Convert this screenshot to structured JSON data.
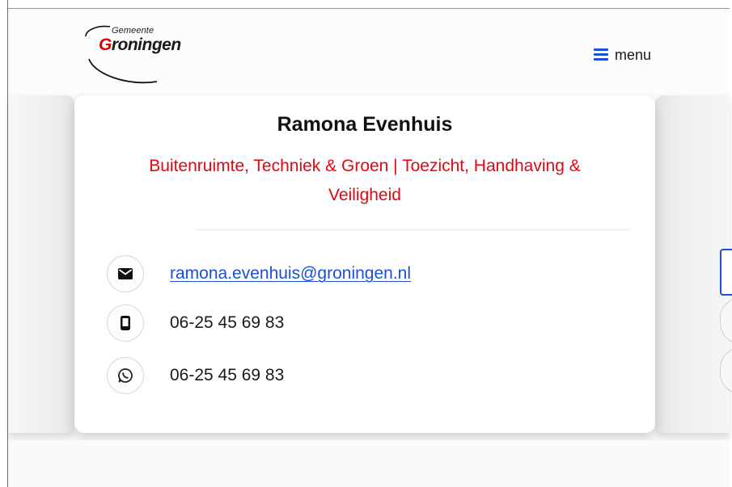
{
  "header": {
    "logo": {
      "subtitle": "Gemeente",
      "name_first_letter": "G",
      "name_rest": "roningen"
    },
    "menu_label": "menu"
  },
  "profile": {
    "name": "Ramona Evenhuis",
    "department": "Buitenruimte, Techniek & Groen | Toezicht, Handhaving & Veiligheid",
    "contacts": {
      "email": "ramona.evenhuis@groningen.nl",
      "phone": "06-25 45 69 83",
      "whatsapp": "06-25 45 69 83"
    }
  },
  "icons": {
    "email": "envelope-icon",
    "phone": "mobile-phone-icon",
    "whatsapp": "whatsapp-icon",
    "menu": "hamburger-menu-icon"
  },
  "colors": {
    "accent_red": "#e30613",
    "link_blue": "#1b4fd6",
    "text": "#111111"
  }
}
